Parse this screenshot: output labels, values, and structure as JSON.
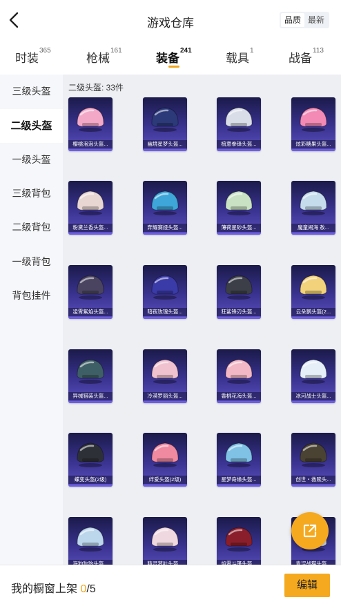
{
  "header": {
    "title": "游戏仓库",
    "sort_options": [
      "品质",
      "最新"
    ],
    "sort_active": 0
  },
  "tabs": [
    {
      "label": "时装",
      "count": "365"
    },
    {
      "label": "枪械",
      "count": "161"
    },
    {
      "label": "装备",
      "count": "241",
      "active": true
    },
    {
      "label": "载具",
      "count": "1"
    },
    {
      "label": "战备",
      "count": "113"
    }
  ],
  "sidebar": [
    {
      "label": "三级头盔"
    },
    {
      "label": "二级头盔",
      "active": true
    },
    {
      "label": "一级头盔"
    },
    {
      "label": "三级背包"
    },
    {
      "label": "二级背包"
    },
    {
      "label": "一级背包"
    },
    {
      "label": "背包挂件"
    }
  ],
  "section_count": "二级头盔: 33件",
  "items": [
    {
      "name": "樱桃泡泡头盔...",
      "color": "#f4a8c8"
    },
    {
      "name": "幽境星梦头盔...",
      "color": "#2c3a7a"
    },
    {
      "name": "梳意拳锋头盔...",
      "color": "#d9dde8"
    },
    {
      "name": "炫彩糖果头盔...",
      "color": "#f28ab5"
    },
    {
      "name": "粉黛兰香头盔...",
      "color": "#e8d6d2"
    },
    {
      "name": "奔耀赛娅头盔...",
      "color": "#3ea6d8"
    },
    {
      "name": "薄荷星砂头盔...",
      "color": "#c9e2c4"
    },
    {
      "name": "魔童闹海 敖...",
      "color": "#c5dcec"
    },
    {
      "name": "凌霄紫焰头盔...",
      "color": "#4a4460"
    },
    {
      "name": "暗夜玫瑰头盔...",
      "color": "#3a3aa8"
    },
    {
      "name": "狂鲨锋刃头盔...",
      "color": "#3c3f48"
    },
    {
      "name": "云朵鹅头盔(2...",
      "color": "#f2d27a"
    },
    {
      "name": "异械猎装头盔...",
      "color": "#3f5f66"
    },
    {
      "name": "冷漠罗丽头盔...",
      "color": "#f0c2cf"
    },
    {
      "name": "香桃花海头盔...",
      "color": "#f2b8c6"
    },
    {
      "name": "冰河战士头盔...",
      "color": "#e6eef8"
    },
    {
      "name": "蝶变头盔(2级)",
      "color": "#2e3038"
    },
    {
      "name": "绊爱头盔(2级)",
      "color": "#f08aa0"
    },
    {
      "name": "星梦奇缘头盔...",
      "color": "#7fc2e6"
    },
    {
      "name": "创世・救赎头...",
      "color": "#4a4232"
    },
    {
      "name": "海豹豹豹头盔...",
      "color": "#bcd6ec"
    },
    {
      "name": "精灵梦叶头盔...",
      "color": "#f0d8e0"
    },
    {
      "name": "焰霄斗篷头盔...",
      "color": "#8a1e2a"
    },
    {
      "name": "青涩战猫头盔...",
      "color": "#cfd8e8"
    }
  ],
  "showcase": {
    "label": "我的橱窗上架",
    "current": "0",
    "total": "/5"
  },
  "edit_label": "编辑",
  "icons": {
    "back": "back-chevron-icon",
    "share": "share-external-icon"
  },
  "colors": {
    "accent": "#f5a91f",
    "card_bg": "#2e2a78"
  }
}
